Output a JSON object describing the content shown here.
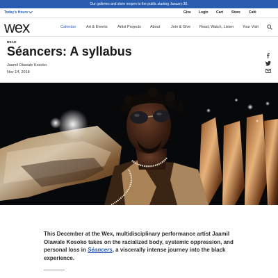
{
  "announcement": "Our galleries and store reopen to the public starting January 30.",
  "utility": {
    "hours_label": "Today's Hours",
    "links": [
      "Give",
      "Login",
      "Cart",
      "Store",
      "Café"
    ]
  },
  "logo": "wex",
  "nav": {
    "items": [
      "Calendar",
      "Art & Events",
      "Artist Projects",
      "About",
      "Join & Give",
      "Read, Watch, Listen",
      "Your Visit"
    ],
    "active_index": 0
  },
  "article": {
    "kicker": "READ",
    "title": "Séancers: A syllabus",
    "author": "Jaamil Olawale Kosoko",
    "date": "Nov 14, 2018",
    "lede_before": "This December at the Wex, multidisciplinary performance artist Jaamil Olawale Kosoko takes on the racialized body, systemic oppression, and personal loss in ",
    "lede_title": "Séancers",
    "lede_after": ", a viscerally intense journey into the black experience."
  },
  "share_icons": [
    "facebook-icon",
    "twitter-icon",
    "email-icon"
  ],
  "colors": {
    "brand_blue": "#2a5db0",
    "text": "#222222",
    "hero_bg": "#07080a"
  }
}
